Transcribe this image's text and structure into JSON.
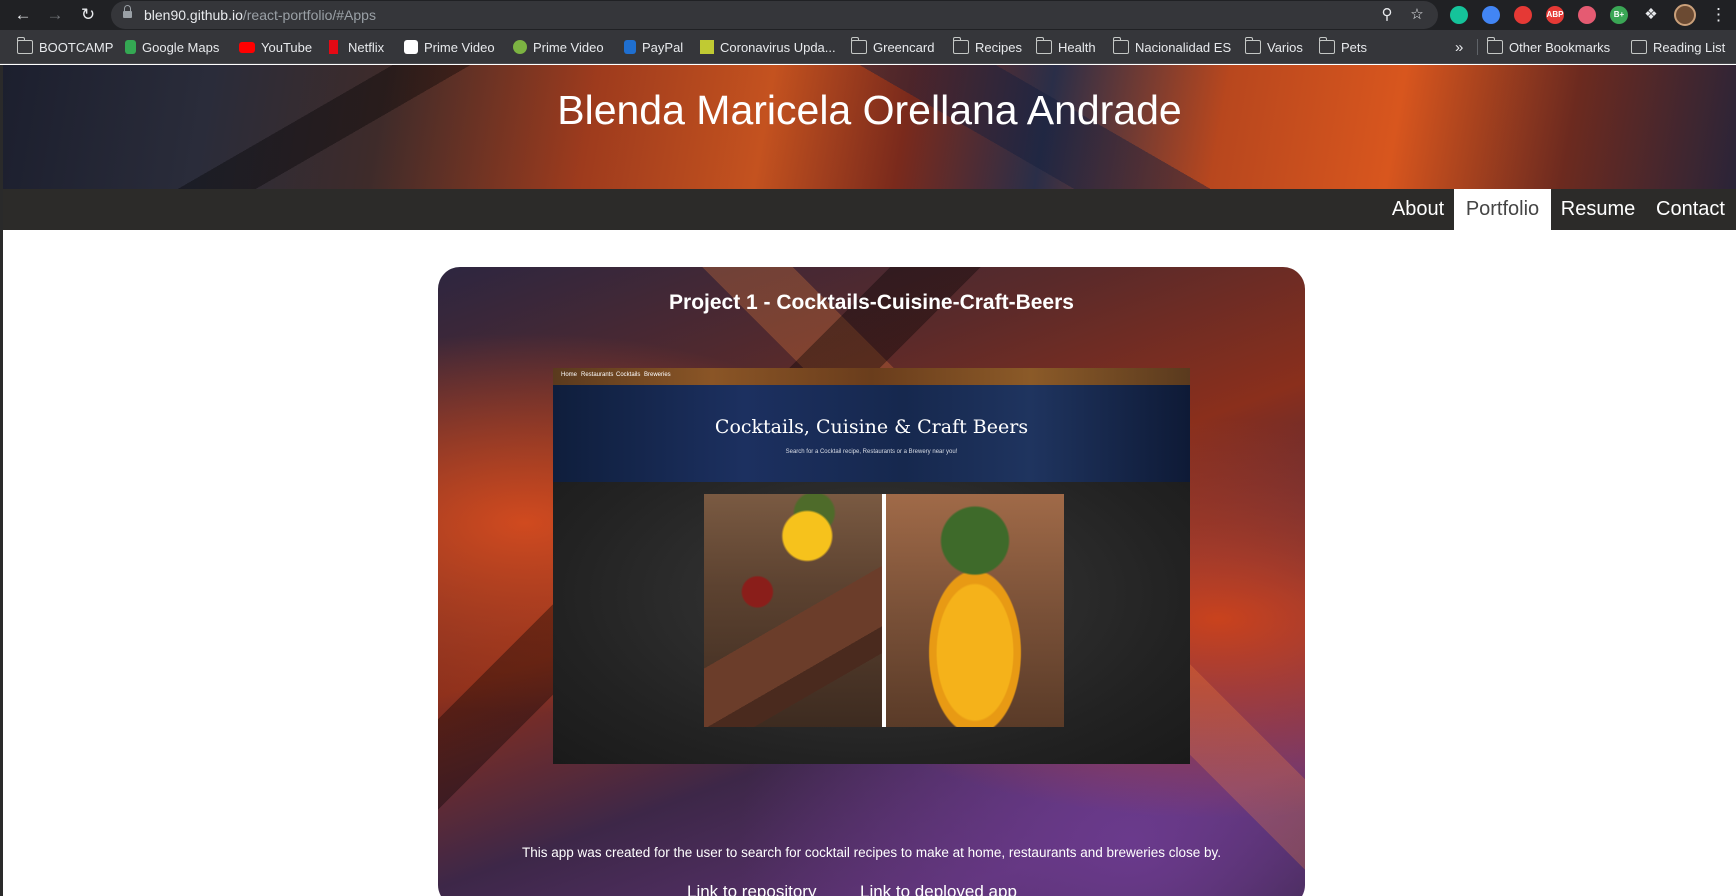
{
  "browser": {
    "url_host": "blen90.github.io",
    "url_path": "/react-portfolio/#Apps",
    "extensions": [
      {
        "name": "grammarly-icon",
        "label": "",
        "color": "#15c39a"
      },
      {
        "name": "chrome-color-icon",
        "label": "",
        "color": "#4285f4"
      },
      {
        "name": "hand-icon",
        "label": "",
        "color": "#e53935"
      },
      {
        "name": "adblock-icon",
        "label": "ABP",
        "color": "#e53935"
      },
      {
        "name": "video-icon",
        "label": "",
        "color": "#e55b72"
      },
      {
        "name": "bplus-icon",
        "label": "B+",
        "color": "#3aa655"
      }
    ],
    "bookmarks": [
      {
        "label": "BOOTCAMP",
        "icon": "folder-icon"
      },
      {
        "label": "Google Maps",
        "icon": "google-maps-icon",
        "color": "#34a853"
      },
      {
        "label": "YouTube",
        "icon": "youtube-icon",
        "color": "#ff0000"
      },
      {
        "label": "Netflix",
        "icon": "netflix-icon",
        "color": "#e50914"
      },
      {
        "label": "Prime Video",
        "icon": "amazon-icon",
        "color": "#ffffff"
      },
      {
        "label": "Prime Video",
        "icon": "prime-video-icon",
        "color": "#7cb342"
      },
      {
        "label": "PayPal",
        "icon": "paypal-icon",
        "color": "#1f6fd0"
      },
      {
        "label": "Coronavirus Upda...",
        "icon": "coronavirus-icon",
        "color": "#c0ca33"
      },
      {
        "label": "Greencard",
        "icon": "folder-icon"
      },
      {
        "label": "Recipes",
        "icon": "folder-icon"
      },
      {
        "label": "Health",
        "icon": "folder-icon"
      },
      {
        "label": "Nacionalidad ES",
        "icon": "folder-icon"
      },
      {
        "label": "Varios",
        "icon": "folder-icon"
      },
      {
        "label": "Pets",
        "icon": "folder-icon"
      }
    ],
    "overflow_label": "»",
    "other_bookmarks": "Other Bookmarks",
    "reading_list": "Reading List"
  },
  "site": {
    "title": "Blenda Maricela Orellana Andrade",
    "nav": [
      {
        "label": "About",
        "active": false
      },
      {
        "label": "Portfolio",
        "active": true
      },
      {
        "label": "Resume",
        "active": false
      },
      {
        "label": "Contact",
        "active": false
      }
    ]
  },
  "project": {
    "title": "Project 1 - Cocktails-Cuisine-Craft-Beers",
    "screenshot": {
      "nav": [
        "Home",
        "Restaurants",
        "Cocktails",
        "Breweries"
      ],
      "title": "Cocktails, Cuisine & Craft Beers",
      "subtitle": "Search for a Cocktail recipe, Restaurants or a Brewery near you!"
    },
    "description": "This app was created for the user to search for cocktail recipes to make at home, restaurants and breweries close by.",
    "repo_link": "Link to repository",
    "deployed_link": "Link to deployed app"
  }
}
